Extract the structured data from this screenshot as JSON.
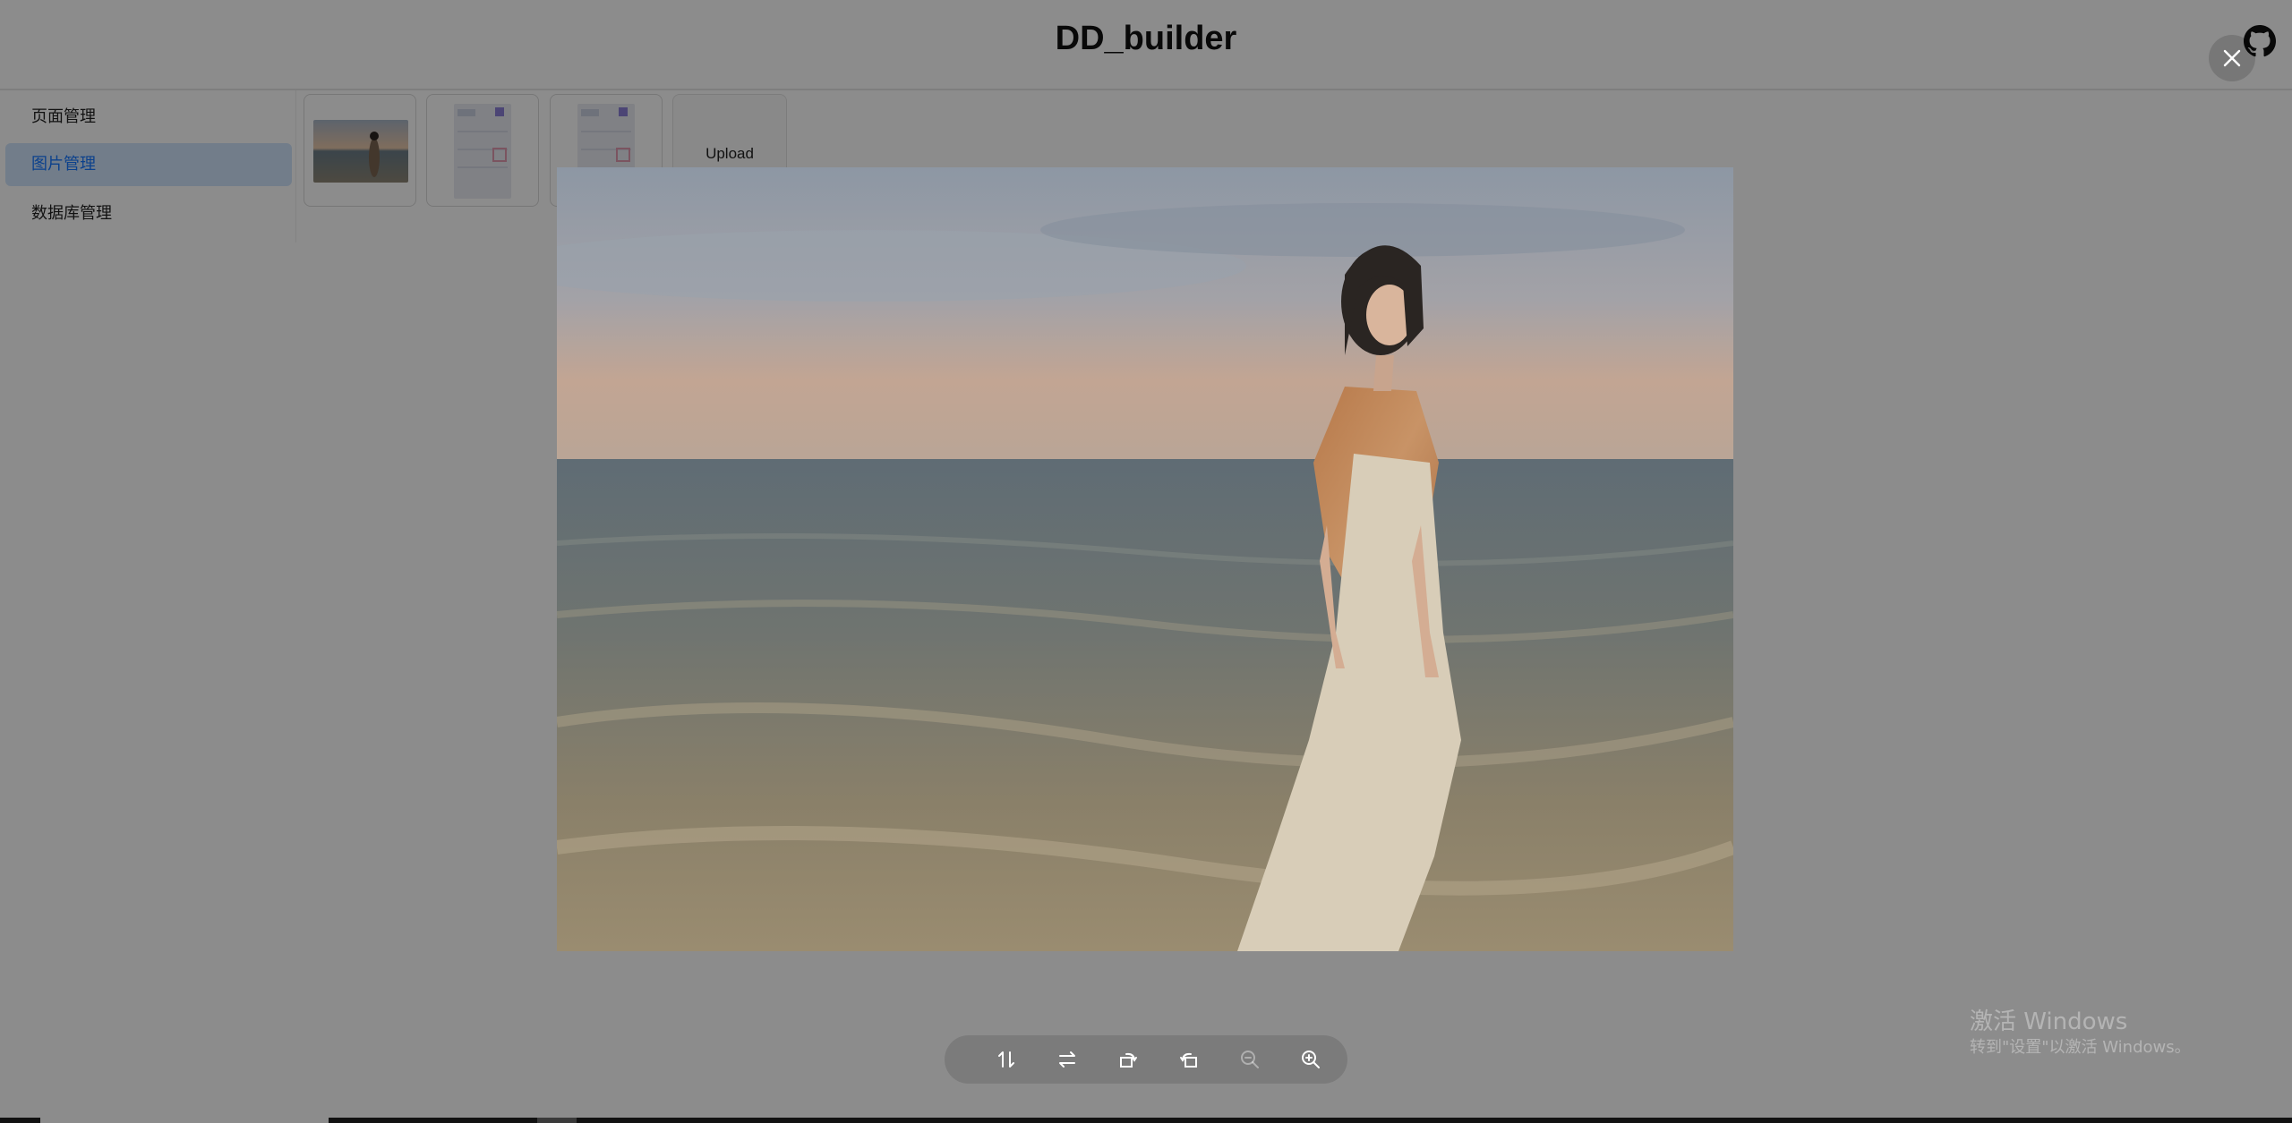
{
  "header": {
    "title": "DD_builder"
  },
  "sidebar": {
    "items": [
      {
        "label": "页面管理"
      },
      {
        "label": "图片管理",
        "active": true
      },
      {
        "label": "数据库管理"
      }
    ]
  },
  "images": {
    "upload_label": "Upload"
  },
  "preview": {
    "toolbar": [
      {
        "icon": "flip-vertical-icon"
      },
      {
        "icon": "flip-horizontal-icon"
      },
      {
        "icon": "rotate-left-icon"
      },
      {
        "icon": "rotate-right-icon"
      },
      {
        "icon": "zoom-out-icon"
      },
      {
        "icon": "zoom-in-icon"
      }
    ]
  },
  "watermark": {
    "title": "激活 Windows",
    "subtitle": "转到\"设置\"以激活 Windows。"
  },
  "colors": {
    "accent": "#1677ff",
    "active_bg": "#cfe3fb",
    "mask": "rgba(0,0,0,0.45)"
  }
}
